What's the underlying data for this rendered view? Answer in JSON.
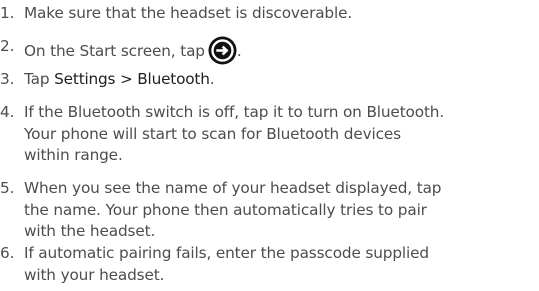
{
  "steps": [
    {
      "number": "1.",
      "text": "Make sure that the headset is discoverable."
    },
    {
      "number": "2.",
      "text_before_icon": "On the Start screen, tap",
      "icon": "arrow-right-circle-icon",
      "text_after_icon": "."
    },
    {
      "number": "3.",
      "text_before": "Tap ",
      "menu_path": "Settings > Bluetooth",
      "text_after": "."
    },
    {
      "number": "4.",
      "lines": [
        "If the Bluetooth switch is off, tap it to turn on Bluetooth.",
        "Your phone will start to scan for Bluetooth devices",
        "within range."
      ]
    },
    {
      "number": "5.",
      "lines": [
        "When you see the name of your headset displayed, tap",
        "the name. Your phone then automatically tries to pair",
        "with the headset."
      ]
    },
    {
      "number": "6.",
      "lines": [
        "If automatic pairing fails, enter the passcode supplied",
        "with your headset."
      ]
    }
  ],
  "colors": {
    "text": "#4d4d4f",
    "emphasis": "#1f1f21",
    "icon_fill": "#111111",
    "icon_glyph": "#ffffff"
  }
}
